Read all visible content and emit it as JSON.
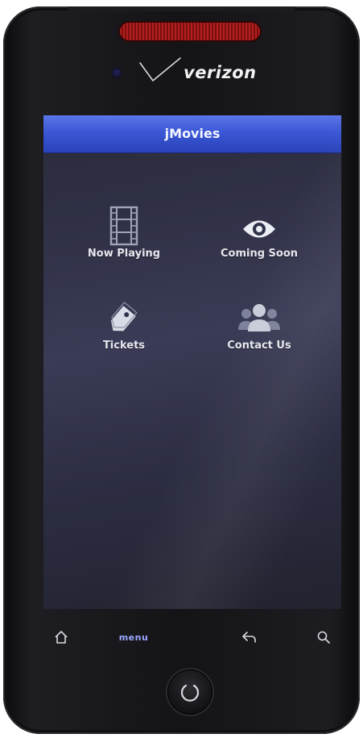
{
  "device": {
    "carrier_brand": "verizon",
    "icons": {
      "speaker": "speaker-grille",
      "camera": "front-camera",
      "logo_check": "verizon-check-icon",
      "trackball": "trackball-icon"
    },
    "colors": {
      "speaker_red": "#b2201f",
      "body": "#141417"
    }
  },
  "app": {
    "title": "jMovies",
    "title_bar_color": "#3b57d6",
    "menu": [
      {
        "label": "Now Playing",
        "icon": "film-strip-icon"
      },
      {
        "label": "Coming Soon",
        "icon": "eye-icon"
      },
      {
        "label": "Tickets",
        "icon": "ticket-tag-icon"
      },
      {
        "label": "Contact Us",
        "icon": "people-icon"
      }
    ]
  },
  "softkeys": {
    "home_icon": "home-icon",
    "menu_label": "menu",
    "back_icon": "back-arrow-icon",
    "search_icon": "search-icon"
  }
}
